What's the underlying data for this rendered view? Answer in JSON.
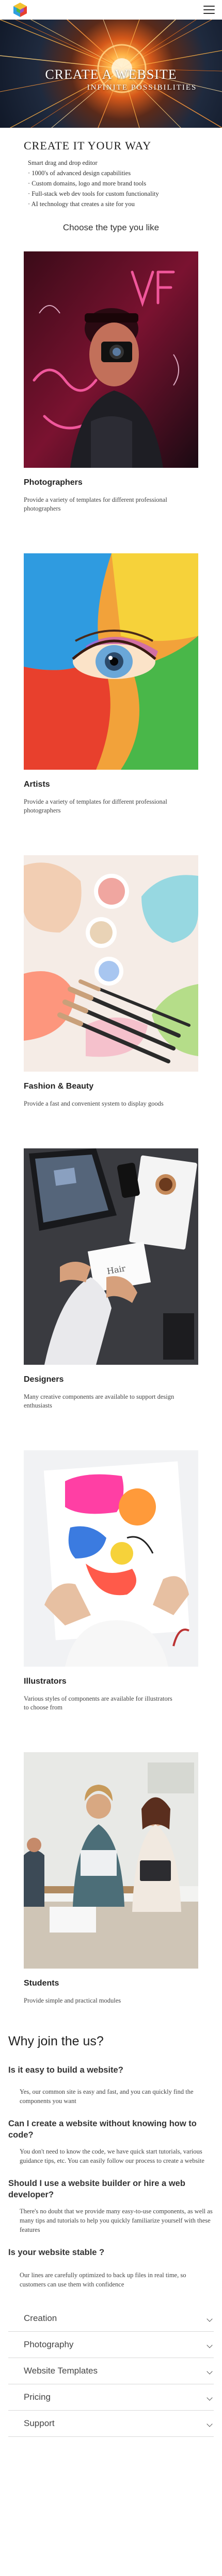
{
  "header": {
    "logo_icon": "multicolor-cube-logo",
    "menu_icon": "hamburger-menu-icon"
  },
  "hero": {
    "title": "CREATE A WEBSITE",
    "subtitle": "INFINITE POSSIBILITIES"
  },
  "intro": {
    "heading": "CREATE IT YOUR WAY",
    "features": [
      "Smart drag and drop editor",
      "· 1000's of advanced design capabilities",
      "· Custom domains, logo and more brand tools",
      "· Full-stack web dev tools for custom functionality",
      "· AI technology that creates a site for you"
    ],
    "choose_label": "Choose the type you like"
  },
  "categories": [
    {
      "title": "Photographers",
      "description": "Provide a variety of templates for different professional photographers"
    },
    {
      "title": "Artists",
      "description": "Provide a variety of templates for different professional photographers"
    },
    {
      "title": "Fashion & Beauty",
      "description": "Provide a fast and convenient system to display goods"
    },
    {
      "title": "Designers",
      "description": "Many creative components are available to support design enthusiasts"
    },
    {
      "title": "Illustrators",
      "description": "Various styles of components are available for illustrators to choose from"
    },
    {
      "title": "Students",
      "description": "Provide simple and practical modules"
    }
  ],
  "faq": {
    "heading": "Why join the us?",
    "items": [
      {
        "q": "Is it easy to build a website?",
        "a": "Yes, our common site is easy and fast, and you can quickly find the components you want"
      },
      {
        "q": "Can I create a website without knowing how to code?",
        "a": "You don't need to know the code, we have quick start tutorials, various guidance tips, etc. You can easily follow our process to create a website"
      },
      {
        "q": "Should I use a website builder or hire a web developer?",
        "a": "There's no doubt that we provide many easy-to-use components, as well as many tips and tutorials to help you quickly familiarize yourself with these features"
      },
      {
        "q": "Is your website stable ?",
        "a": "Our lines are carefully optimized to back up files in real time, so customers can use them with confidence"
      }
    ]
  },
  "accordion": [
    {
      "label": "Creation"
    },
    {
      "label": "Photography"
    },
    {
      "label": "Website Templates"
    },
    {
      "label": "Pricing"
    },
    {
      "label": "Support"
    }
  ],
  "colors": {
    "hero_accent": "#ff8c2a",
    "text": "#333333",
    "divider": "#d8d8d8"
  }
}
